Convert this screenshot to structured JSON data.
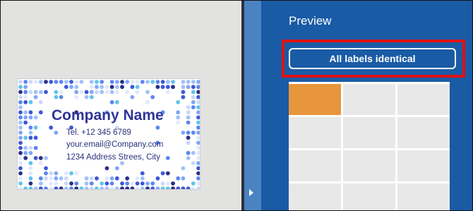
{
  "card": {
    "company_name": "Company Name",
    "tel": "Tel. +12 345 6789",
    "email": "your.email@Company.com",
    "address": "1234 Address Strees, City"
  },
  "panel": {
    "title": "Preview",
    "identical_button_label": "All labels identical"
  },
  "label_grid": {
    "columns": 3,
    "rows": 4,
    "selected_index": 0
  },
  "colors": {
    "panel_bg": "#1a5ba6",
    "sidebar_bg": "#4b83c2",
    "selected_label": "#e8963c",
    "highlight_border": "#e01111",
    "company_text": "#2e3596"
  },
  "icons": {
    "sidebar_toggle": "chevron-right-icon"
  }
}
